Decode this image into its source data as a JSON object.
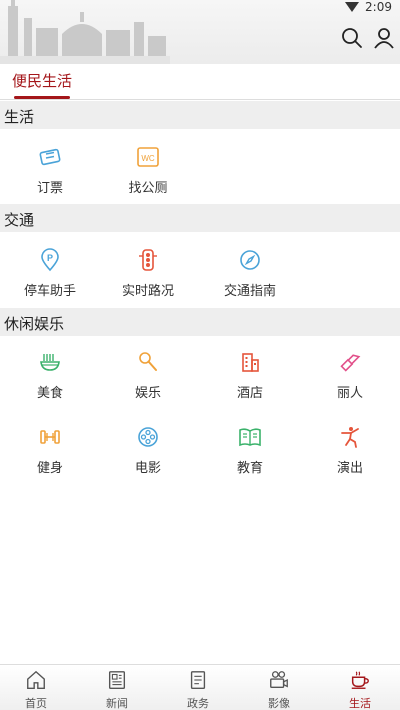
{
  "status": {
    "time": "2:09"
  },
  "tabs": [
    {
      "label": "便民生活",
      "active": true
    }
  ],
  "sections": [
    {
      "title": "生活",
      "items": [
        {
          "label": "订票",
          "icon": "ticket-icon",
          "color": "#4aa3d8"
        },
        {
          "label": "找公厕",
          "icon": "wc-icon",
          "color": "#f0a23a"
        }
      ]
    },
    {
      "title": "交通",
      "items": [
        {
          "label": "停车助手",
          "icon": "parking-icon",
          "color": "#4aa3d8"
        },
        {
          "label": "实时路况",
          "icon": "traffic-light-icon",
          "color": "#e5553b"
        },
        {
          "label": "交通指南",
          "icon": "compass-icon",
          "color": "#4aa3d8"
        }
      ]
    },
    {
      "title": "休闲娱乐",
      "items": [
        {
          "label": "美食",
          "icon": "noodle-bowl-icon",
          "color": "#3bb26b"
        },
        {
          "label": "娱乐",
          "icon": "microphone-icon",
          "color": "#f0a23a"
        },
        {
          "label": "酒店",
          "icon": "hotel-icon",
          "color": "#e5553b"
        },
        {
          "label": "丽人",
          "icon": "lipstick-icon",
          "color": "#e2508a"
        },
        {
          "label": "健身",
          "icon": "dumbbell-icon",
          "color": "#f0a23a"
        },
        {
          "label": "电影",
          "icon": "film-reel-icon",
          "color": "#4aa3d8"
        },
        {
          "label": "教育",
          "icon": "book-icon",
          "color": "#3bb26b"
        },
        {
          "label": "演出",
          "icon": "dancer-icon",
          "color": "#e5553b"
        }
      ]
    }
  ],
  "nav": [
    {
      "label": "首页",
      "icon": "home-icon",
      "active": false
    },
    {
      "label": "新闻",
      "icon": "newspaper-icon",
      "active": false
    },
    {
      "label": "政务",
      "icon": "document-icon",
      "active": false
    },
    {
      "label": "影像",
      "icon": "video-camera-icon",
      "active": false
    },
    {
      "label": "生活",
      "icon": "coffee-cup-icon",
      "active": true
    }
  ],
  "colors": {
    "accent": "#a4161a"
  }
}
